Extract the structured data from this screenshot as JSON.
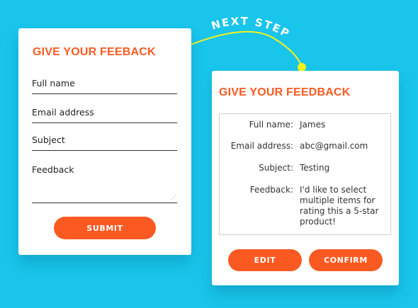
{
  "connector": {
    "label": "NEXT STEP"
  },
  "form": {
    "title": "GIVE YOUR FEEBACK",
    "fields": {
      "full_name": "Full name",
      "email": "Email address",
      "subject": "Subject",
      "feedback": "Feedback"
    },
    "submit_label": "SUBMIT"
  },
  "review": {
    "title": "GIVE YOUR FEEDBACK",
    "rows": [
      {
        "label": "Full name:",
        "value": "James"
      },
      {
        "label": "Email address:",
        "value": "abc@gmail.com"
      },
      {
        "label": "Subject:",
        "value": "Testing"
      },
      {
        "label": "Feedback:",
        "value": "I'd like to select multiple items for rating this a 5-star product!"
      }
    ],
    "edit_label": "EDIT",
    "confirm_label": "CONFIRM"
  },
  "colors": {
    "background": "#19c5ea",
    "accent": "#fa5a22",
    "connector": "#f5f21a"
  }
}
